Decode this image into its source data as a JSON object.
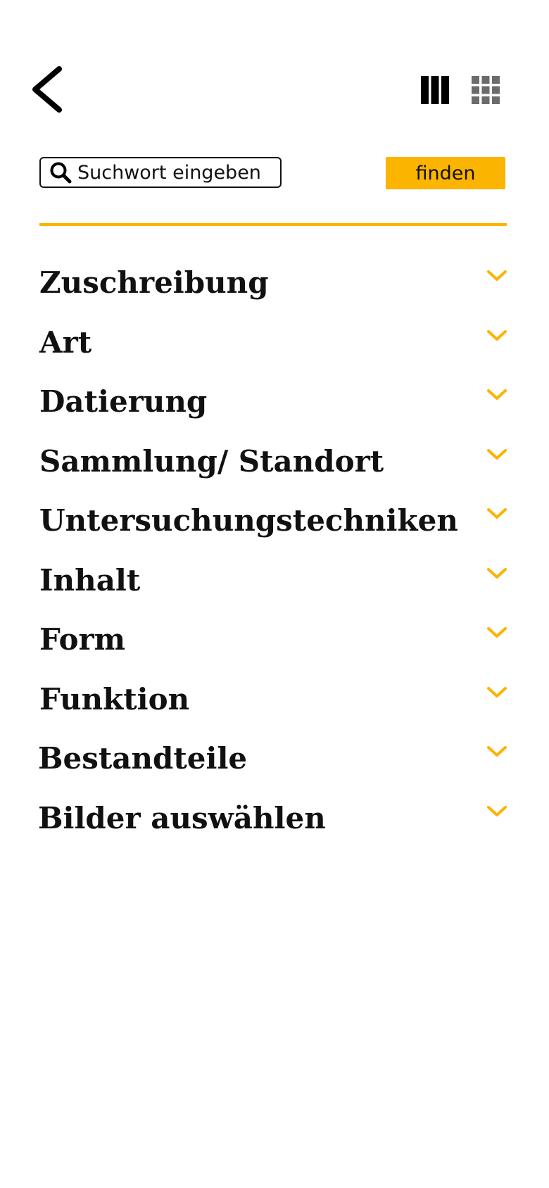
{
  "header": {
    "back_icon": "chevron-left-icon",
    "view_columns_icon": "columns-icon",
    "view_grid_icon": "grid-icon"
  },
  "search": {
    "placeholder": "Suchwort eingeben",
    "button_label": "finden",
    "icon": "search-icon"
  },
  "colors": {
    "accent": "#fbb400",
    "text": "#111111",
    "inactive_icon": "#6b6b6b"
  },
  "filters": [
    {
      "label": "Zuschreibung"
    },
    {
      "label": "Art"
    },
    {
      "label": "Datierung"
    },
    {
      "label": "Sammlung/ Standort"
    },
    {
      "label": "Untersuchungstechniken"
    },
    {
      "label": "Inhalt"
    },
    {
      "label": "Form"
    },
    {
      "label": "Funktion"
    },
    {
      "label": "Bestandteile"
    },
    {
      "label": "Bilder auswählen"
    }
  ]
}
